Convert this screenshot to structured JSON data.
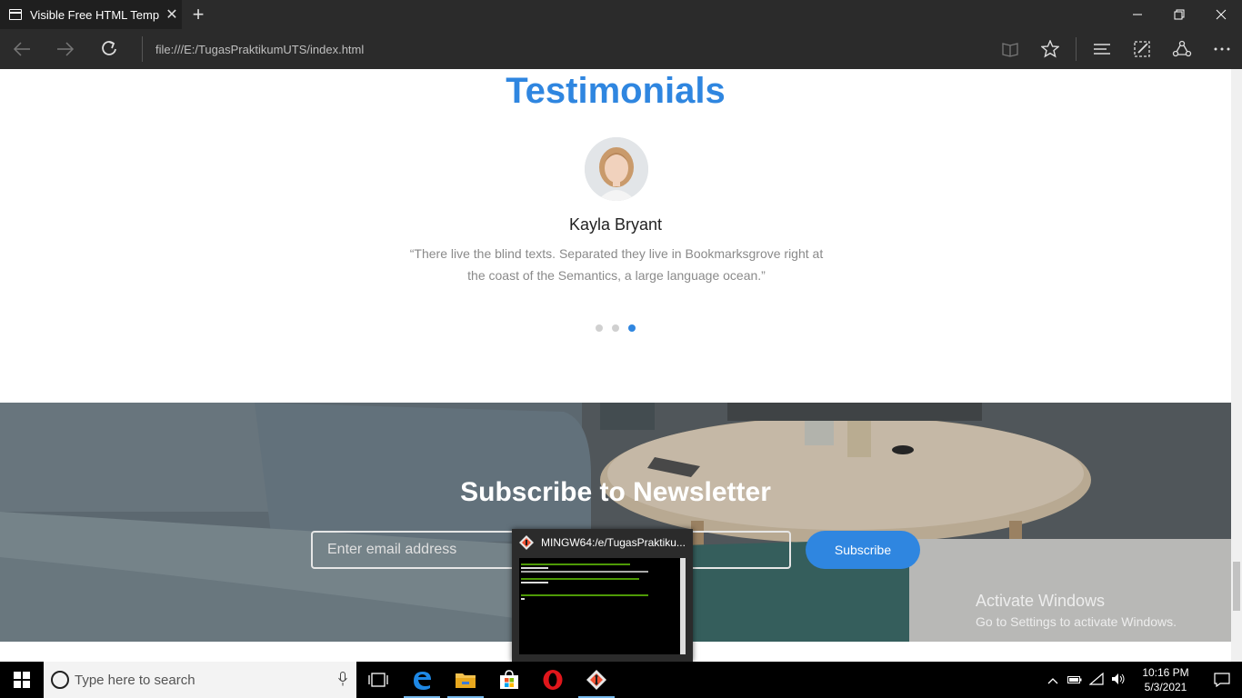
{
  "browser": {
    "tab_title": "Visible Free HTML Temp",
    "address": "file:///E:/TugasPraktikumUTS/index.html",
    "new_tab_label": "+",
    "tab_close_label": "✕"
  },
  "testimonials": {
    "heading": "Testimonials",
    "name": "Kayla Bryant",
    "quote": "“There live the blind texts. Separated they live in Bookmarksgrove right at the coast of the Semantics, a large language ocean.”",
    "slides_total": 3,
    "active_slide": 3
  },
  "newsletter": {
    "heading": "Subscribe to Newsletter",
    "email_placeholder": "Enter email address",
    "button_label": "Subscribe"
  },
  "watermark": {
    "line1": "Activate Windows",
    "line2": "Go to Settings to activate Windows."
  },
  "git_popup": {
    "title": "MINGW64:/e/TugasPraktiku..."
  },
  "taskbar": {
    "search_placeholder": "Type here to search",
    "time": "10:16 PM",
    "date": "5/3/2021",
    "pinned": [
      "task-view-icon",
      "edge-icon",
      "file-explorer-icon",
      "store-icon",
      "opera-icon",
      "git-icon"
    ]
  },
  "colors": {
    "accent": "#2f86e0",
    "browser_chrome": "#2b2b2b"
  }
}
